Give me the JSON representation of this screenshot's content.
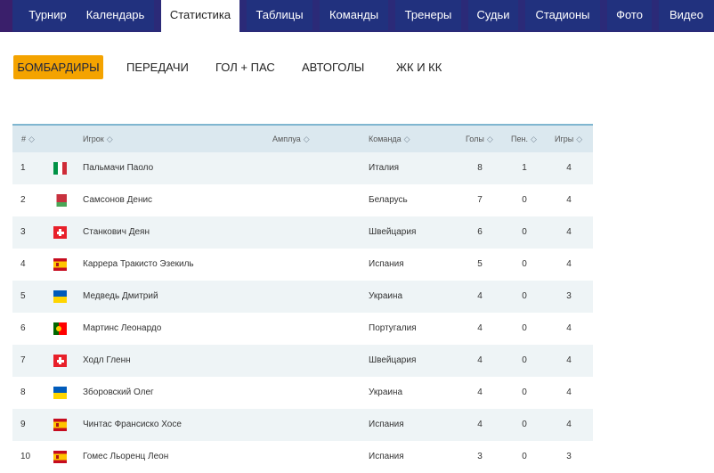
{
  "topnav": {
    "tabs": [
      {
        "label": "Турнир"
      },
      {
        "label": "Календарь"
      },
      {
        "label": "Статистика",
        "active": true
      },
      {
        "label": "Таблицы"
      },
      {
        "label": "Команды"
      },
      {
        "label": "Тренеры"
      },
      {
        "label": "Судьи"
      },
      {
        "label": "Стадионы"
      },
      {
        "label": "Фото"
      },
      {
        "label": "Видео"
      }
    ]
  },
  "subnav": {
    "items": [
      {
        "label": "БОМБАРДИРЫ",
        "active": true
      },
      {
        "label": "ПЕРЕДАЧИ"
      },
      {
        "label": "ГОЛ + ПАС"
      },
      {
        "label": "АВТОГОЛЫ"
      },
      {
        "label": "ЖК И КК"
      }
    ]
  },
  "table": {
    "sort_glyph": "◇",
    "headers": {
      "rank": "#",
      "player": "Игрок",
      "role": "Амплуа",
      "team": "Команда",
      "goals": "Голы",
      "penalties": "Пен.",
      "games": "Игры"
    },
    "rows": [
      {
        "rank": "1",
        "flag": "it",
        "player": "Пальмачи Паоло",
        "team": "Италия",
        "goals": "8",
        "penalties": "1",
        "games": "4"
      },
      {
        "rank": "2",
        "flag": "by",
        "player": "Самсонов Денис",
        "team": "Беларусь",
        "goals": "7",
        "penalties": "0",
        "games": "4"
      },
      {
        "rank": "3",
        "flag": "ch",
        "player": "Станкович Деян",
        "team": "Швейцария",
        "goals": "6",
        "penalties": "0",
        "games": "4"
      },
      {
        "rank": "4",
        "flag": "es",
        "player": "Каррера Тракисто Эзекиль",
        "team": "Испания",
        "goals": "5",
        "penalties": "0",
        "games": "4"
      },
      {
        "rank": "5",
        "flag": "ua",
        "player": "Медведь Дмитрий",
        "team": "Украина",
        "goals": "4",
        "penalties": "0",
        "games": "3"
      },
      {
        "rank": "6",
        "flag": "pt",
        "player": "Мартинс Леонардо",
        "team": "Португалия",
        "goals": "4",
        "penalties": "0",
        "games": "4"
      },
      {
        "rank": "7",
        "flag": "ch",
        "player": "Ходл Гленн",
        "team": "Швейцария",
        "goals": "4",
        "penalties": "0",
        "games": "4"
      },
      {
        "rank": "8",
        "flag": "ua",
        "player": "Зборовский Олег",
        "team": "Украина",
        "goals": "4",
        "penalties": "0",
        "games": "4"
      },
      {
        "rank": "9",
        "flag": "es",
        "player": "Чинтас Франсиско Хосе",
        "team": "Испания",
        "goals": "4",
        "penalties": "0",
        "games": "4"
      },
      {
        "rank": "10",
        "flag": "es",
        "player": "Гомес Льоренц Леон",
        "team": "Испания",
        "goals": "3",
        "penalties": "0",
        "games": "3"
      }
    ]
  },
  "colors": {
    "nav_bg": "#2b2a78",
    "tab_bg": "#21317e",
    "accent": "#f4a300",
    "header_bg": "#dbe8ef",
    "header_border": "#7fb6d0",
    "row_alt": "#eef4f6"
  }
}
